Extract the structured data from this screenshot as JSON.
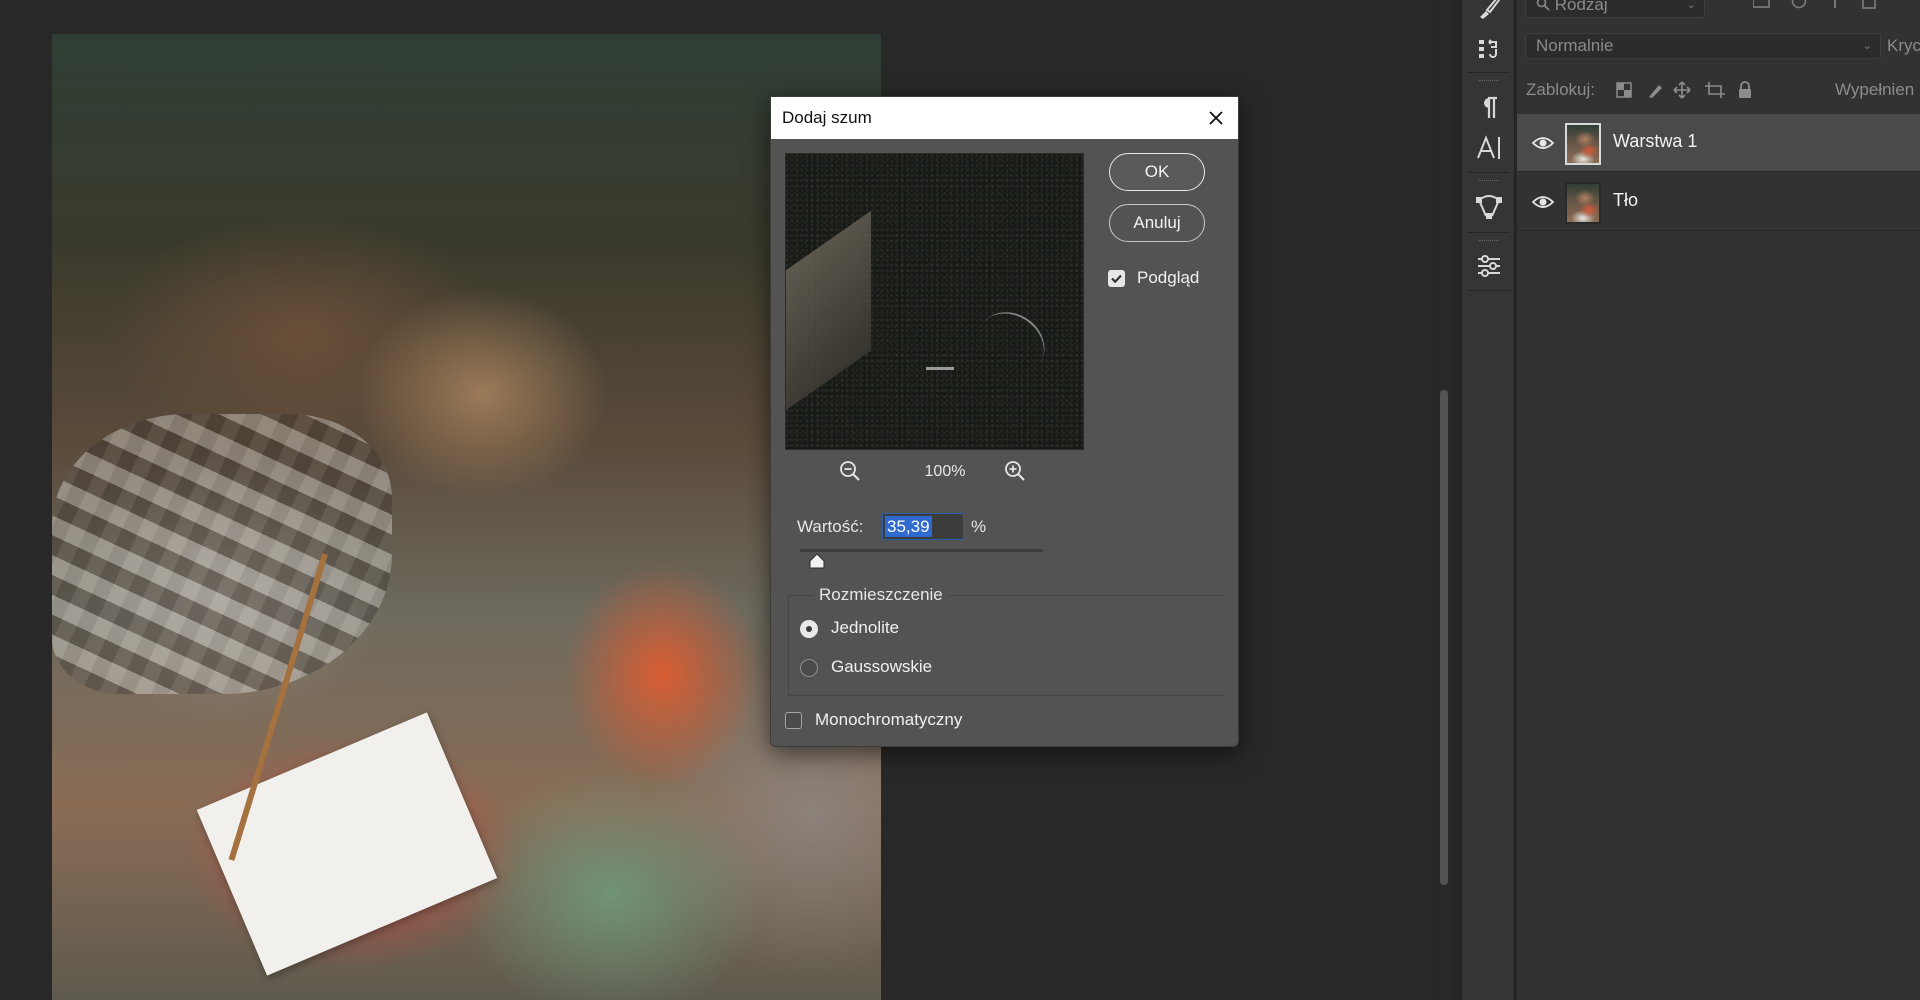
{
  "dialog": {
    "title": "Dodaj szum",
    "ok_label": "OK",
    "cancel_label": "Anuluj",
    "preview_checkbox_label": "Podgląd",
    "preview_checked": true,
    "zoom_level": "100%",
    "amount_label": "Wartość:",
    "amount_value": "35,39",
    "amount_unit": "%",
    "amount_slider_percent": 7,
    "distribution_legend": "Rozmieszczenie",
    "distribution_options": [
      {
        "label": "Jednolite",
        "selected": true
      },
      {
        "label": "Gaussowskie",
        "selected": false
      }
    ],
    "monochromatic_label": "Monochromatyczny",
    "monochromatic_checked": false
  },
  "layers_panel": {
    "filter_kind": "Rodzaj",
    "blend_mode": "Normalnie",
    "opacity_label_cut": "Kryc",
    "lock_label": "Zablokuj:",
    "fill_label_cut": "Wypełnien",
    "layers": [
      {
        "name": "Warstwa 1",
        "visible": true,
        "active": true
      },
      {
        "name": "Tło",
        "visible": true,
        "active": false
      }
    ]
  },
  "tools": [
    "brush-settings-icon",
    "clone-source-icon",
    "paragraph-icon",
    "character-icon",
    "paths-icon",
    "properties-icon"
  ],
  "colors": {
    "app_background": "#262626",
    "dialog_background": "#535353",
    "panel_background": "#323232",
    "selection_highlight": "#2f6ad0"
  }
}
